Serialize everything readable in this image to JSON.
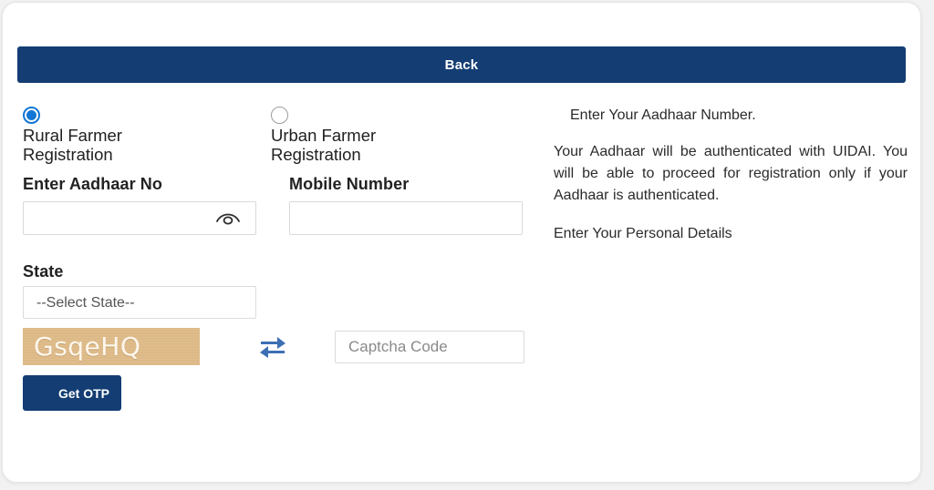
{
  "theme": {
    "primary_navy": "#133d73",
    "radio_blue": "#1277d4",
    "captcha_bg": "#ddb987",
    "refresh_blue": "#3d6fb4",
    "card_bg": "#ffffff",
    "page_bg": "#f2f2f2"
  },
  "nav": {
    "back_label": "Back"
  },
  "registration_type": {
    "options": [
      {
        "label": "Rural Farmer\nRegistration",
        "selected": true
      },
      {
        "label": "Urban Farmer\nRegistration",
        "selected": false
      }
    ]
  },
  "form": {
    "aadhaar": {
      "label": "Enter Aadhaar No",
      "value": "",
      "placeholder": "",
      "toggle_icon": "eye-icon"
    },
    "mobile": {
      "label": "Mobile Number",
      "value": "",
      "placeholder": ""
    },
    "state": {
      "label": "State",
      "selected": "--Select State--",
      "options": [
        "--Select State--"
      ]
    },
    "captcha": {
      "image_text": "GsqeHQ",
      "refresh_icon": "refresh-icon",
      "input_value": "",
      "input_placeholder": "Captcha Code"
    },
    "submit": {
      "label": "Get OTP"
    }
  },
  "info": {
    "heading": "Enter Your Aadhaar Number.",
    "body": "Your Aadhaar will be authenticated with UIDAI. You will be able to proceed for registration only if your Aadhaar is authenticated.",
    "subheading": "Enter Your Personal Details"
  }
}
